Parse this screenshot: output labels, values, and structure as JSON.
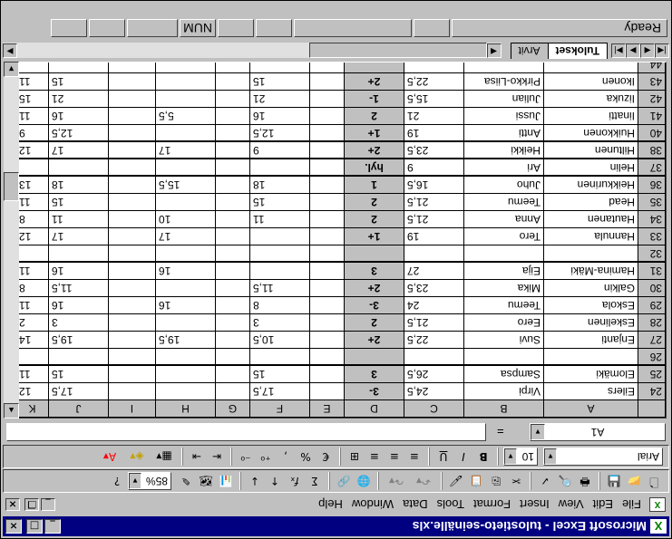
{
  "window": {
    "title": "Microsoft Excel - tulostieto-seinälle.xls",
    "caption_buttons": [
      "_",
      "□",
      "×"
    ]
  },
  "menu": {
    "items": [
      "File",
      "Edit",
      "View",
      "Insert",
      "Format",
      "Tools",
      "Data",
      "Window",
      "Help"
    ],
    "doc_buttons": [
      "_",
      "❐",
      "×"
    ]
  },
  "toolbar": {
    "zoom": "85%",
    "font": "Arial",
    "font_size": "10",
    "bold": "B",
    "italic": "I",
    "underline": "U"
  },
  "formula_bar": {
    "cell_ref": "A1",
    "equals": "=",
    "value": ""
  },
  "sheet": {
    "columns": [
      "A",
      "B",
      "C",
      "D",
      "E",
      "F",
      "G",
      "H",
      "I",
      "J",
      "K"
    ],
    "rows": [
      {
        "num": "24",
        "last": "Eilers",
        "first": "Virpi",
        "c": "24,5",
        "d": "3-",
        "f": "17,5",
        "h": "",
        "j": "17,5",
        "k": "12"
      },
      {
        "num": "25",
        "last": "Elomäki",
        "first": "Sampsa",
        "c": "26,5",
        "d": "3",
        "f": "15",
        "h": "",
        "j": "15",
        "k": "11"
      },
      {
        "num": "26",
        "last": "",
        "first": "",
        "c": "",
        "d": "",
        "f": "",
        "h": "",
        "j": "",
        "k": ""
      },
      {
        "num": "27",
        "last": "Enjanti",
        "first": "Suvi",
        "c": "22,5",
        "d": "2+",
        "f": "10,5",
        "h": "19,5",
        "j": "19,5",
        "k": "14"
      },
      {
        "num": "28",
        "last": "Eskelinen",
        "first": "Eero",
        "c": "21,5",
        "d": "2",
        "f": "3",
        "h": "",
        "j": "3",
        "k": "2"
      },
      {
        "num": "29",
        "last": "Eskola",
        "first": "Teemu",
        "c": "24",
        "d": "3-",
        "f": "8",
        "h": "16",
        "j": "16",
        "k": "11"
      },
      {
        "num": "30",
        "last": "Galkin",
        "first": "Mika",
        "c": "23,5",
        "d": "2+",
        "f": "11,5",
        "h": "",
        "j": "11,5",
        "k": "8"
      },
      {
        "num": "31",
        "last": "Hamina-Mäki",
        "first": "Eija",
        "c": "27",
        "d": "3",
        "f": "",
        "h": "16",
        "j": "16",
        "k": "11"
      },
      {
        "num": "32",
        "last": "",
        "first": "",
        "c": "",
        "d": "",
        "f": "",
        "h": "",
        "j": "",
        "k": ""
      },
      {
        "num": "33",
        "last": "Hannula",
        "first": "Tero",
        "c": "19",
        "d": "1+",
        "f": "",
        "h": "17",
        "j": "17",
        "k": "12"
      },
      {
        "num": "34",
        "last": "Hautanen",
        "first": "Anna",
        "c": "21,5",
        "d": "2",
        "f": "11",
        "h": "10",
        "j": "11",
        "k": "8"
      },
      {
        "num": "35",
        "last": "Head",
        "first": "Teemu",
        "c": "21,5",
        "d": "2",
        "f": "15",
        "h": "",
        "j": "15",
        "k": "11"
      },
      {
        "num": "36",
        "last": "Heikkurinen",
        "first": "Juho",
        "c": "16,5",
        "d": "1",
        "f": "18",
        "h": "15,5",
        "j": "18",
        "k": "13"
      },
      {
        "num": "37",
        "last": "Helin",
        "first": "Ari",
        "c": "9",
        "d": "hyl.",
        "f": "",
        "h": "",
        "j": "",
        "k": ""
      },
      {
        "num": "38",
        "last": "Hiltunen",
        "first": "Heikki",
        "c": "23,5",
        "d": "2+",
        "f": "9",
        "h": "17",
        "j": "17",
        "k": "12"
      },
      {
        "num": "40",
        "last": "Huikkonen",
        "first": "Antti",
        "c": "19",
        "d": "1+",
        "f": "12,5",
        "h": "",
        "j": "12,5",
        "k": "9"
      },
      {
        "num": "41",
        "last": "Iinatti",
        "first": "Jussi",
        "c": "21",
        "d": "2",
        "f": "16",
        "h": "5,5",
        "j": "16",
        "k": "11"
      },
      {
        "num": "42",
        "last": "Iizuka",
        "first": "Julian",
        "c": "15,5",
        "d": "1-",
        "f": "21",
        "h": "",
        "j": "21",
        "k": "15"
      },
      {
        "num": "43",
        "last": "Ikonen",
        "first": "Pirkko-Liisa",
        "c": "22,5",
        "d": "2+",
        "f": "15",
        "h": "",
        "j": "15",
        "k": "11"
      },
      {
        "num": "44",
        "last": "",
        "first": "",
        "c": "",
        "d": "",
        "f": "",
        "h": "",
        "j": "",
        "k": ""
      }
    ]
  },
  "tabs": [
    "Tulokset",
    "Arvit"
  ],
  "status": {
    "ready": "Ready",
    "num": "NUM"
  },
  "colors": {
    "title_bar": "#000080",
    "chrome": "#c0c0c0",
    "highlight_column": "#c0c0c0"
  }
}
